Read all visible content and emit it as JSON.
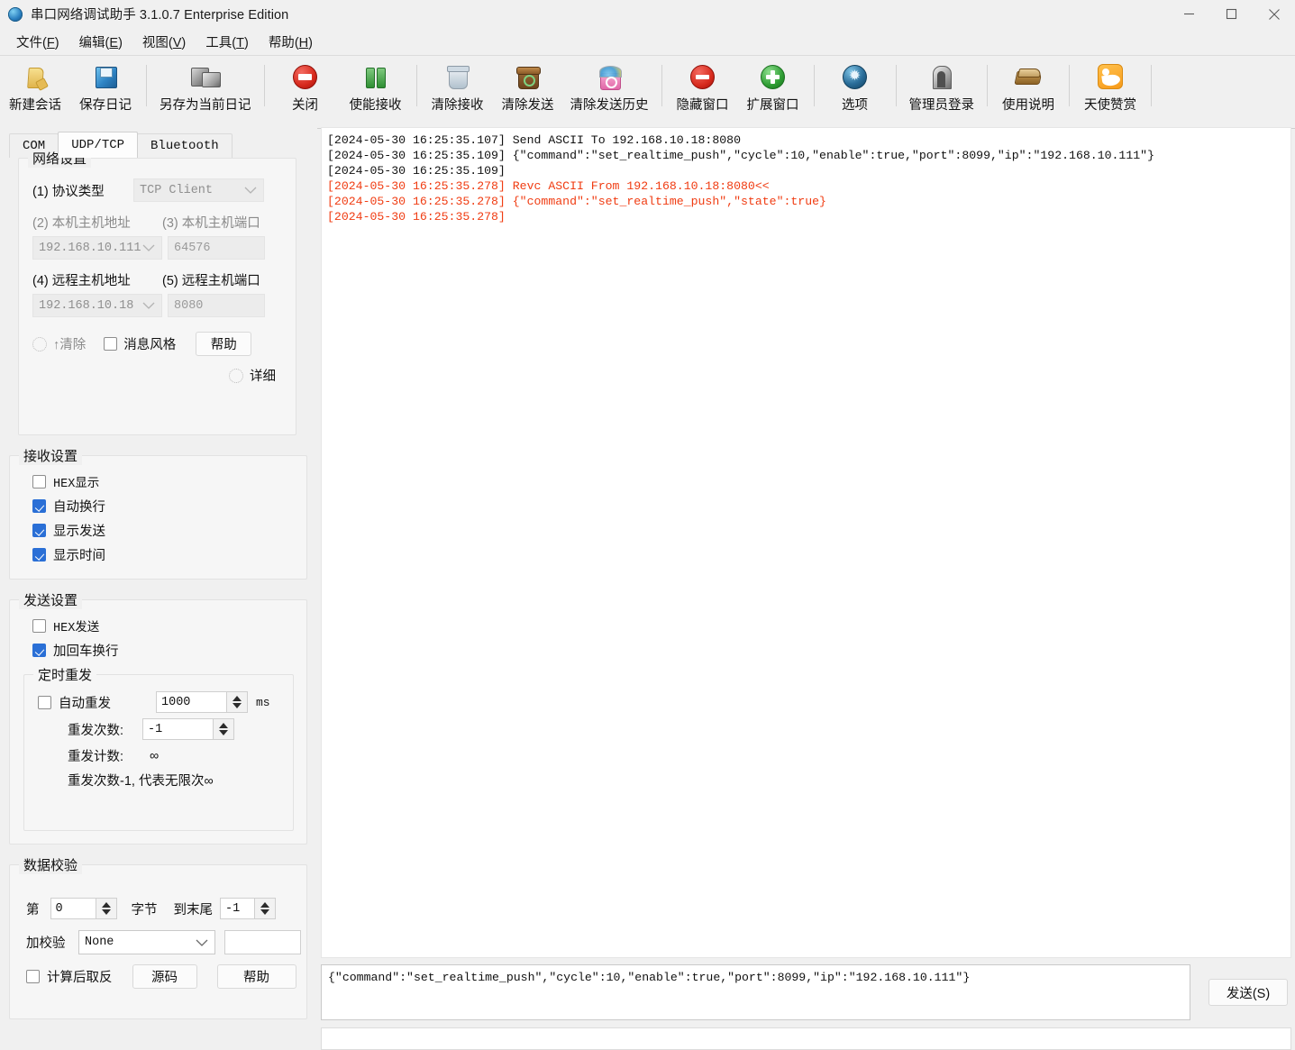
{
  "window": {
    "title": "串口网络调试助手 3.1.0.7 Enterprise Edition",
    "icon": "app-globe-icon",
    "minimize": "−",
    "maximize": "□",
    "close": "✕"
  },
  "menubar": [
    {
      "label": "文件",
      "accel": "F"
    },
    {
      "label": "编辑",
      "accel": "E"
    },
    {
      "label": "视图",
      "accel": "V"
    },
    {
      "label": "工具",
      "accel": "T"
    },
    {
      "label": "帮助",
      "accel": "H"
    }
  ],
  "toolbar": [
    {
      "label": "新建会话",
      "icon": "new-session-folder-icon"
    },
    {
      "label": "保存日记",
      "icon": "save-floppy-icon"
    },
    {
      "label": "另存为当前日记",
      "icon": "save-as-floppy-icon"
    },
    {
      "label": "关闭",
      "icon": "close-stop-icon"
    },
    {
      "label": "使能接收",
      "icon": "pause-receive-icon"
    },
    {
      "label": "清除接收",
      "icon": "clear-receive-trash-icon"
    },
    {
      "label": "清除发送",
      "icon": "clear-send-bin-icon"
    },
    {
      "label": "清除发送历史",
      "icon": "clear-send-history-bin-icon"
    },
    {
      "label": "隐藏窗口",
      "icon": "hide-window-minus-icon"
    },
    {
      "label": "扩展窗口",
      "icon": "expand-window-plus-icon"
    },
    {
      "label": "选项",
      "icon": "options-gear-icon"
    },
    {
      "label": "管理员登录",
      "icon": "admin-login-door-icon"
    },
    {
      "label": "使用说明",
      "icon": "manual-book-icon"
    },
    {
      "label": "天使赞赏",
      "icon": "angel-donate-icon"
    }
  ],
  "tabs": [
    {
      "label": "COM",
      "active": false
    },
    {
      "label": "UDP/TCP",
      "active": true
    },
    {
      "label": "Bluetooth",
      "active": false
    }
  ],
  "network_settings": {
    "legend": "网络设置",
    "protocol_label": "(1) 协议类型",
    "protocol_value": "TCP Client",
    "local_addr_label": "(2) 本机主机地址",
    "local_port_label": "(3) 本机主机端口",
    "local_addr_value": "192.168.10.111",
    "local_port_value": "64576",
    "remote_addr_label": "(4) 远程主机地址",
    "remote_port_label": "(5) 远程主机端口",
    "remote_addr_value": "192.168.10.18",
    "remote_port_value": "8080",
    "clear_label": "↑清除",
    "msg_style_label": "消息风格",
    "help_button": "帮助",
    "detail_label": "详细"
  },
  "receive_settings": {
    "legend": "接收设置",
    "items": [
      {
        "label": "HEX显示",
        "checked": false,
        "mono": true
      },
      {
        "label": "自动换行",
        "checked": true,
        "mono": false
      },
      {
        "label": "显示发送",
        "checked": true,
        "mono": false
      },
      {
        "label": "显示时间",
        "checked": true,
        "mono": false
      }
    ]
  },
  "send_settings": {
    "legend": "发送设置",
    "items": [
      {
        "label": "HEX发送",
        "checked": false
      },
      {
        "label": "加回车换行",
        "checked": true
      }
    ],
    "timer": {
      "legend": "定时重发",
      "auto_resend_label": "自动重发",
      "auto_resend_checked": false,
      "interval_value": "1000",
      "interval_unit": "ms",
      "count_label": "重发次数:",
      "count_value": "-1",
      "counter_label": "重发计数:",
      "counter_value": "∞",
      "note": "重发次数-1, 代表无限次∞"
    }
  },
  "data_check": {
    "legend": "数据校验",
    "from_label": "第",
    "from_value": "0",
    "byte_label": "字节",
    "to_label": "到末尾",
    "to_value": "-1",
    "checksum_label": "加校验",
    "checksum_value": "None",
    "result_value": "",
    "invert_label": "计算后取反",
    "invert_checked": false,
    "source_button": "源码",
    "help_button": "帮助"
  },
  "log": {
    "lines": [
      {
        "text": "[2024-05-30 16:25:35.107] Send ASCII To 192.168.10.18:8080",
        "type": "send"
      },
      {
        "text": "[2024-05-30 16:25:35.109] {\"command\":\"set_realtime_push\",\"cycle\":10,\"enable\":true,\"port\":8099,\"ip\":\"192.168.10.111\"}",
        "type": "send"
      },
      {
        "text": "[2024-05-30 16:25:35.109]",
        "type": "send"
      },
      {
        "text": "[2024-05-30 16:25:35.278] Revc ASCII From 192.168.10.18:8080<<",
        "type": "recv"
      },
      {
        "text": "[2024-05-30 16:25:35.278] {\"command\":\"set_realtime_push\",\"state\":true}",
        "type": "recv"
      },
      {
        "text": "[2024-05-30 16:25:35.278]",
        "type": "recv"
      }
    ]
  },
  "send_area": {
    "value": "{\"command\":\"set_realtime_push\",\"cycle\":10,\"enable\":true,\"port\":8099,\"ip\":\"192.168.10.111\"}",
    "send_button": "发送(S)"
  },
  "colors": {
    "recv_text": "#f03c12",
    "accent_checkbox": "#2a6fd6",
    "panel_bg": "#f0f0f0",
    "group_bg": "#f6f6f6"
  }
}
